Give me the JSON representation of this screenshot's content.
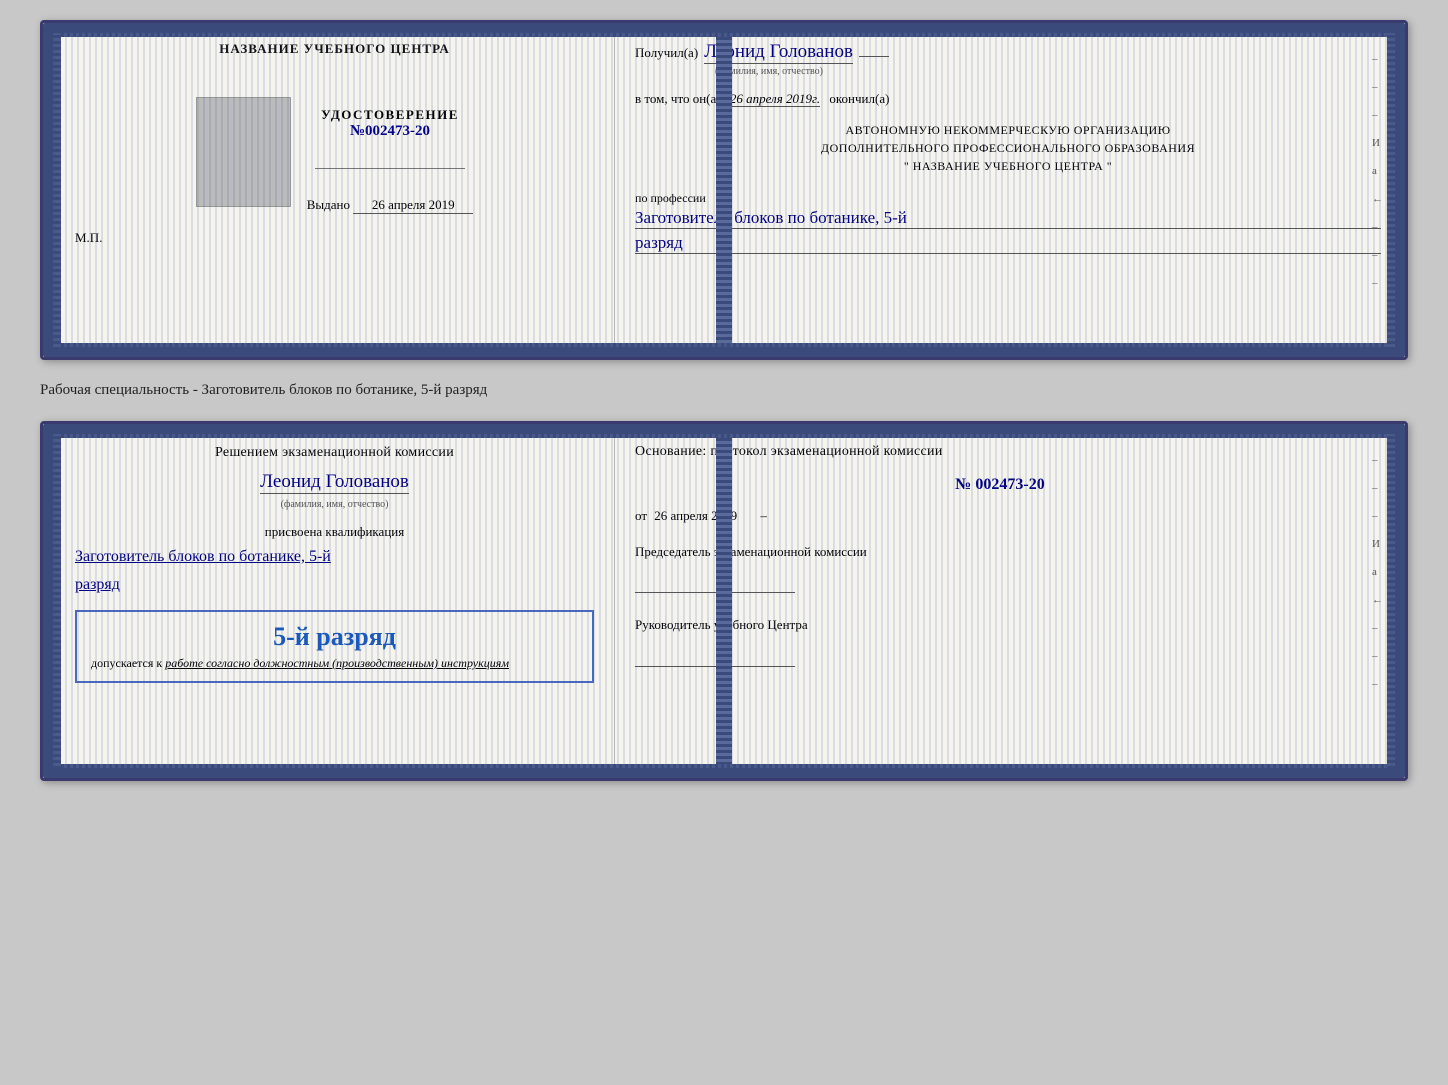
{
  "card1": {
    "left": {
      "training_center": "НАЗВАНИЕ УЧЕБНОГО ЦЕНТРА",
      "cert_label": "УДОСТОВЕРЕНИЕ",
      "cert_no_prefix": "№",
      "cert_number": "002473-20",
      "issued_label": "Выдано",
      "issued_date": "26 апреля 2019",
      "stamp_label": "М.П."
    },
    "right": {
      "recipient_prefix": "Получил(а)",
      "recipient_name": "Леонид Голованов",
      "name_caption": "(фамилия, имя, отчество)",
      "date_prefix": "в том, что он(а)",
      "date_value": "26 апреля 2019г.",
      "date_suffix": "окончил(а)",
      "org_line1": "АВТОНОМНУЮ НЕКОММЕРЧЕСКУЮ ОРГАНИЗАЦИЮ",
      "org_line2": "ДОПОЛНИТЕЛЬНОГО ПРОФЕССИОНАЛЬНОГО ОБРАЗОВАНИЯ",
      "org_line3": "\"  НАЗВАНИЕ УЧЕБНОГО ЦЕНТРА  \"",
      "profession_label": "по профессии",
      "profession_value": "Заготовитель блоков по ботанике, 5-й",
      "rank_value": "разряд"
    }
  },
  "specialty_label": "Рабочая специальность - Заготовитель блоков по ботанике, 5-й разряд",
  "card2": {
    "left": {
      "decision_line1": "Решением экзаменационной комиссии",
      "person_name": "Леонид Голованов",
      "name_caption": "(фамилия, имя, отчество)",
      "qualification_label": "присвоена квалификация",
      "qualification_value": "Заготовитель блоков по ботанике, 5-й",
      "rank_value": "разряд",
      "admit_rank": "5-й разряд",
      "admit_prefix": "допускается к",
      "admit_text_italic": "работе согласно должностным (производственным) инструкциям"
    },
    "right": {
      "basis_label": "Основание: протокол экзаменационной комиссии",
      "protocol_no_prefix": "№",
      "protocol_number": "002473-20",
      "date_prefix": "от",
      "date_value": "26 апреля 2019",
      "chairman_label": "Председатель экзаменационной комиссии",
      "center_head_label": "Руководитель учебного Центра"
    }
  },
  "side_marks": [
    "–",
    "И",
    "а",
    "←",
    "–",
    "–",
    "–",
    "–"
  ]
}
